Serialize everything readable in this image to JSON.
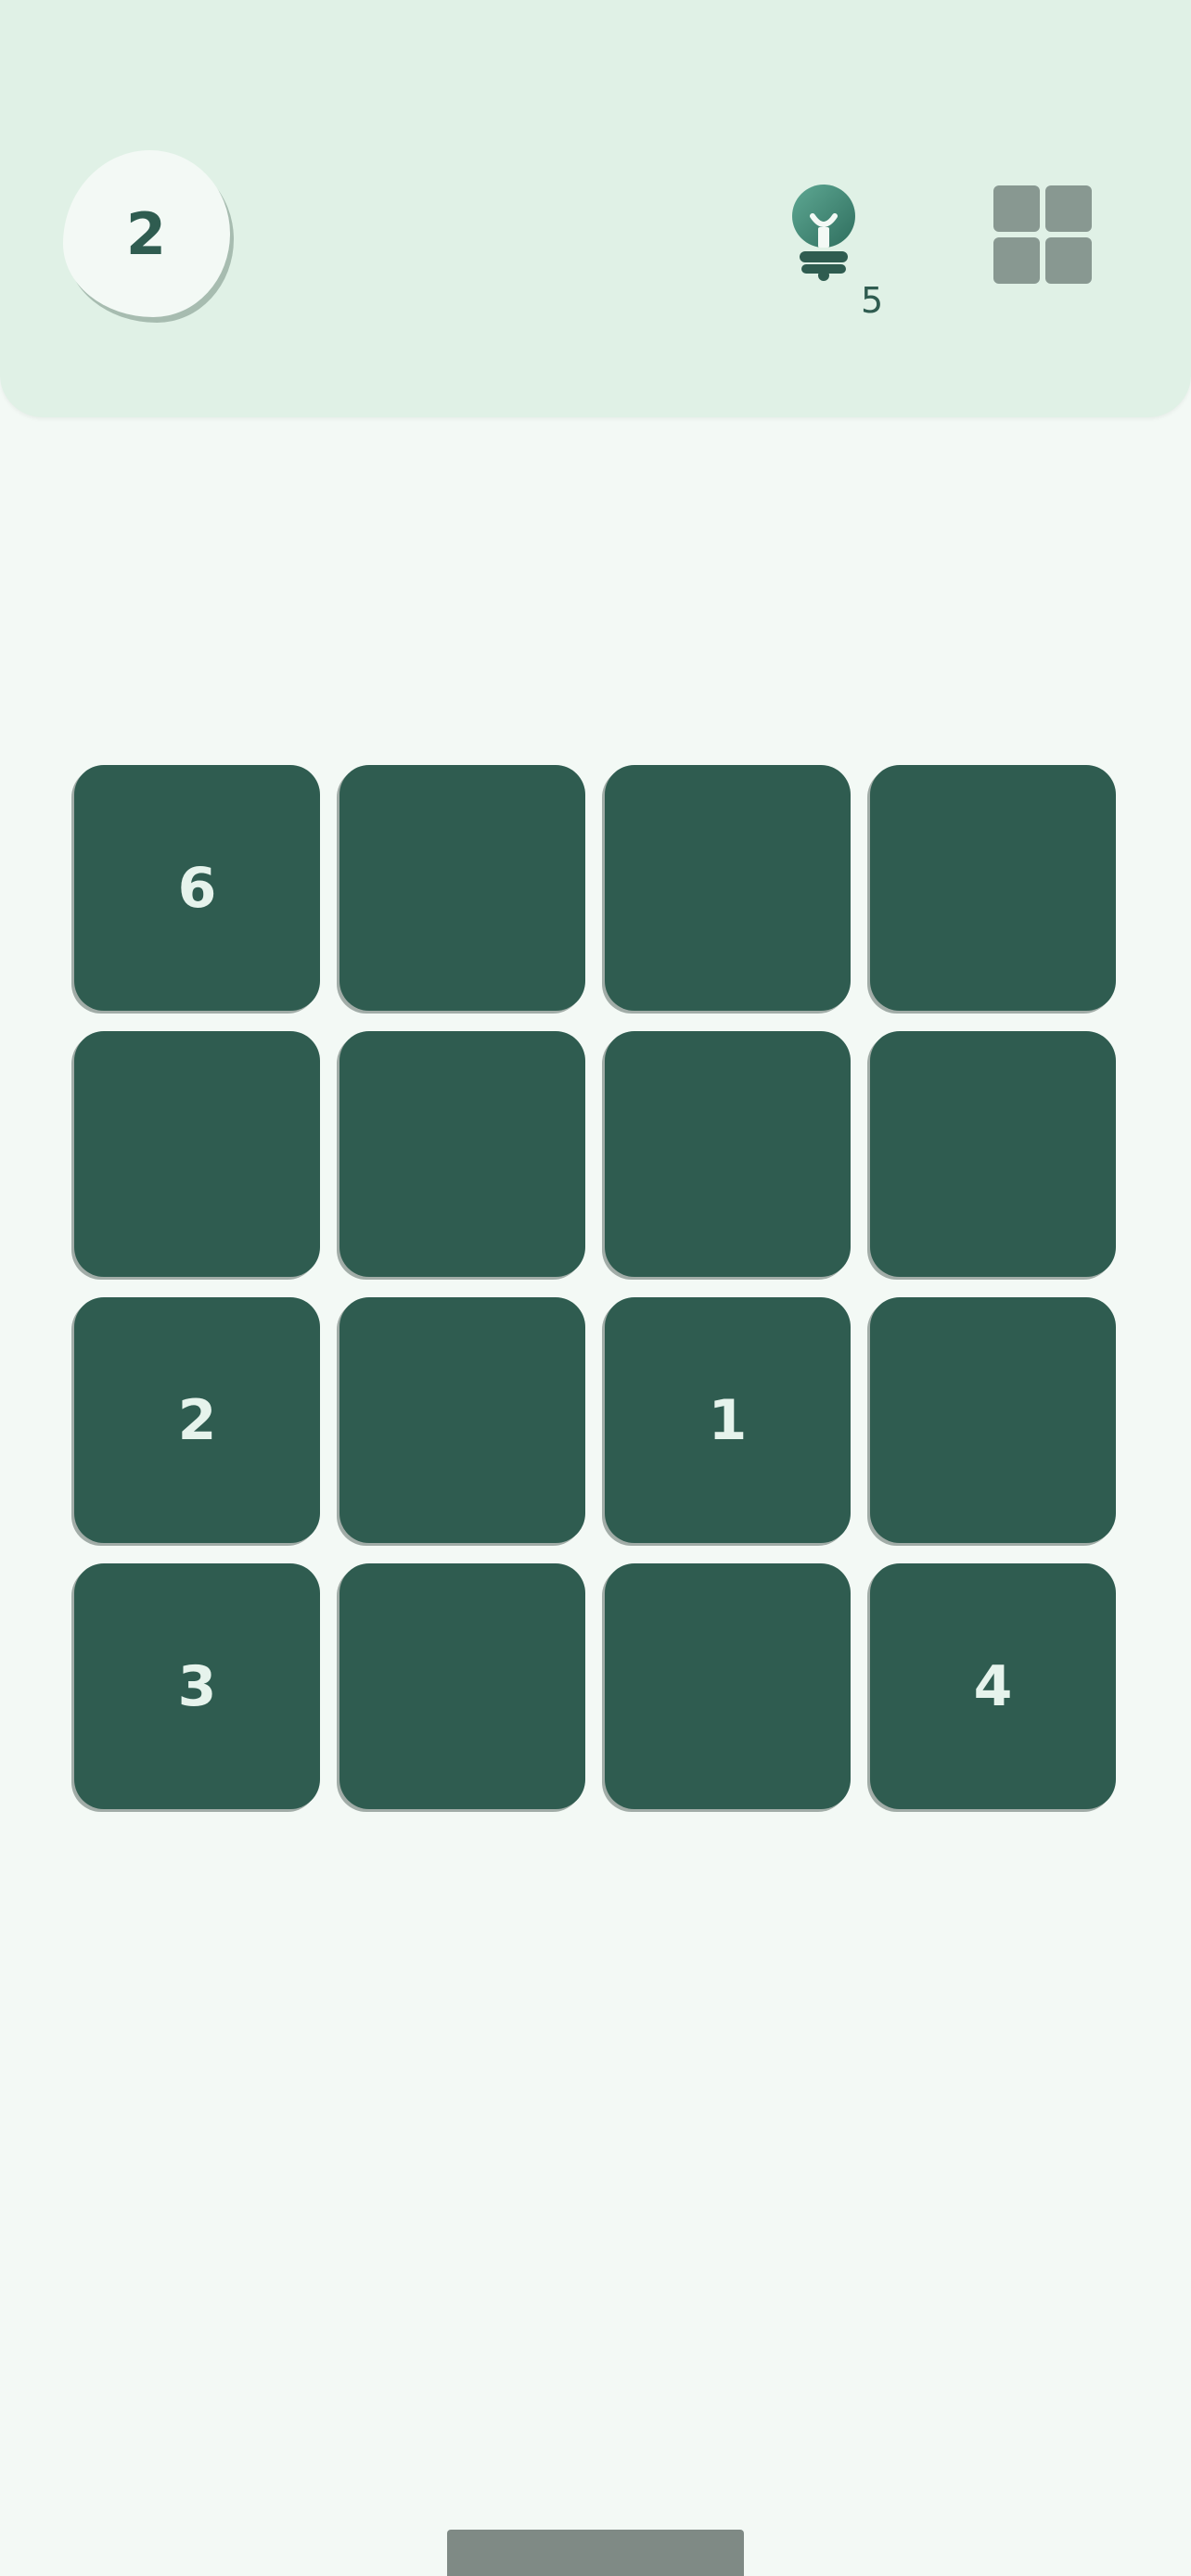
{
  "colors": {
    "page_background": "#f3f9f5",
    "header_background": "#e0f1e6",
    "accent_dark": "#2f5c50",
    "tile_text": "#e6f3ec",
    "icon_grey": "#889891",
    "home_indicator": "#7f8a85",
    "hint_bulb": "#4e9681"
  },
  "header": {
    "level": "2",
    "hint": {
      "icon": "lightbulb-icon",
      "count": "5"
    },
    "menu": {
      "icon": "grid-icon"
    }
  },
  "board": {
    "rows": 4,
    "columns": 4,
    "tiles": [
      "6",
      "",
      "",
      "",
      "",
      "",
      "",
      "",
      "2",
      "",
      "1",
      "",
      "3",
      "",
      "",
      "4"
    ]
  }
}
